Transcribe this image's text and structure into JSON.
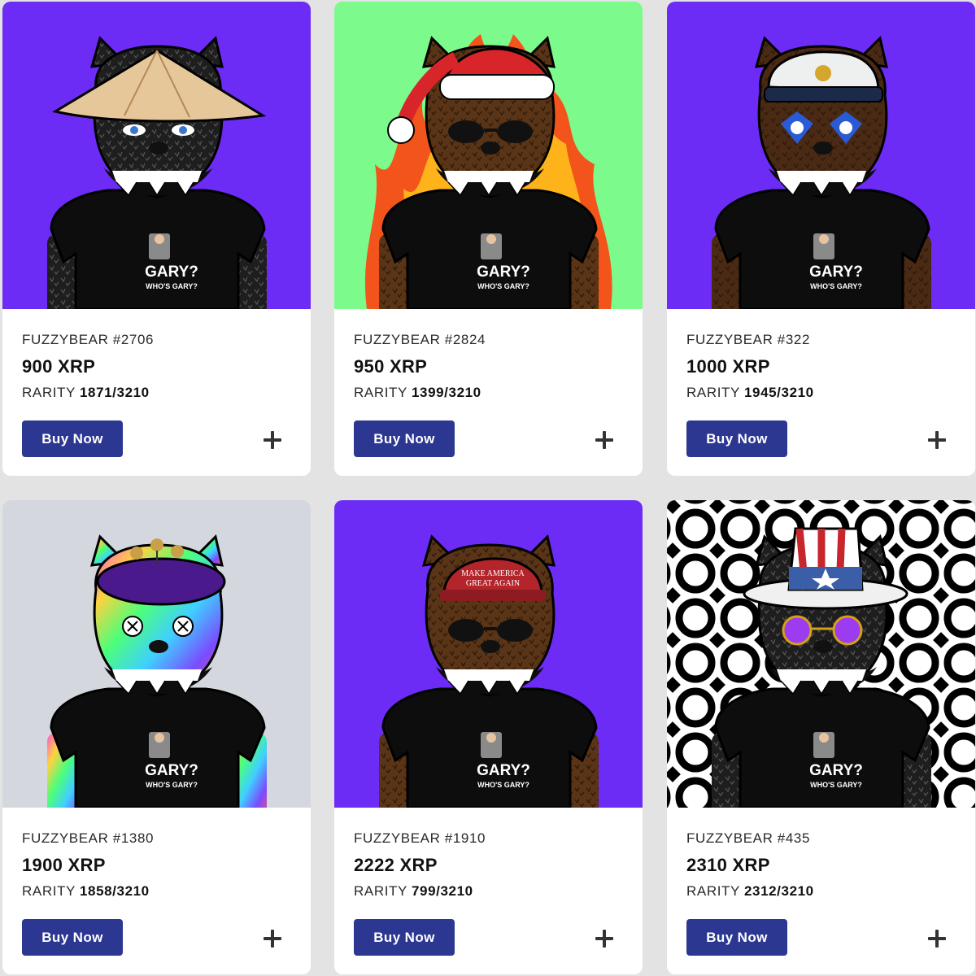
{
  "cards": [
    {
      "name": "FUZZYBEAR #2706",
      "price": "900 XRP",
      "rarity_label": "RARITY",
      "rarity_value": "1871/3210",
      "button": "Buy Now",
      "bg": "#6d2cf5",
      "fur": "#1e1e1e",
      "hat": "conical straw hat",
      "eyes": "blue",
      "skin": "plain",
      "background_kind": "solid"
    },
    {
      "name": "FUZZYBEAR #2824",
      "price": "950 XRP",
      "rarity_label": "RARITY",
      "rarity_value": "1399/3210",
      "button": "Buy Now",
      "bg": "#7dfa8c",
      "fur": "#5a3416",
      "hat": "santa hat",
      "eyes": "sunglasses",
      "skin": "plain",
      "background_kind": "fire"
    },
    {
      "name": "FUZZYBEAR #322",
      "price": "1000 XRP",
      "rarity_label": "RARITY",
      "rarity_value": "1945/3210",
      "button": "Buy Now",
      "bg": "#6d2cf5",
      "fur": "#4a2a14",
      "hat": "captain hat",
      "eyes": "clown paint",
      "skin": "plain",
      "background_kind": "solid"
    },
    {
      "name": "FUZZYBEAR #1380",
      "price": "1900 XRP",
      "rarity_label": "RARITY",
      "rarity_value": "1858/3210",
      "button": "Buy Now",
      "bg": "#d4d8de",
      "fur": "rainbow",
      "hat": "purple beret",
      "eyes": "x eyes",
      "skin": "rainbow",
      "background_kind": "solid"
    },
    {
      "name": "FUZZYBEAR #1910",
      "price": "2222 XRP",
      "rarity_label": "RARITY",
      "rarity_value": "799/3210",
      "button": "Buy Now",
      "bg": "#6d2cf5",
      "fur": "#5a3416",
      "hat": "red cap",
      "eyes": "dark",
      "skin": "plain",
      "background_kind": "solid"
    },
    {
      "name": "FUZZYBEAR #435",
      "price": "2310 XRP",
      "rarity_label": "RARITY",
      "rarity_value": "2312/3210",
      "button": "Buy Now",
      "bg": "#ffffff",
      "fur": "#1e1e1e",
      "hat": "uncle sam top hat",
      "eyes": "purple round glasses",
      "skin": "plain",
      "background_kind": "pattern"
    }
  ],
  "shirt_text": {
    "line1": "GARY?",
    "line2": "WHO'S GARY?"
  },
  "cap_text": {
    "line1": "MAKE AMERICA",
    "line2": "GREAT AGAIN"
  },
  "icons": {
    "add": "plus-icon"
  },
  "colors": {
    "button": "#2b3791",
    "card": "#ffffff",
    "page": "#e3e3e3"
  }
}
